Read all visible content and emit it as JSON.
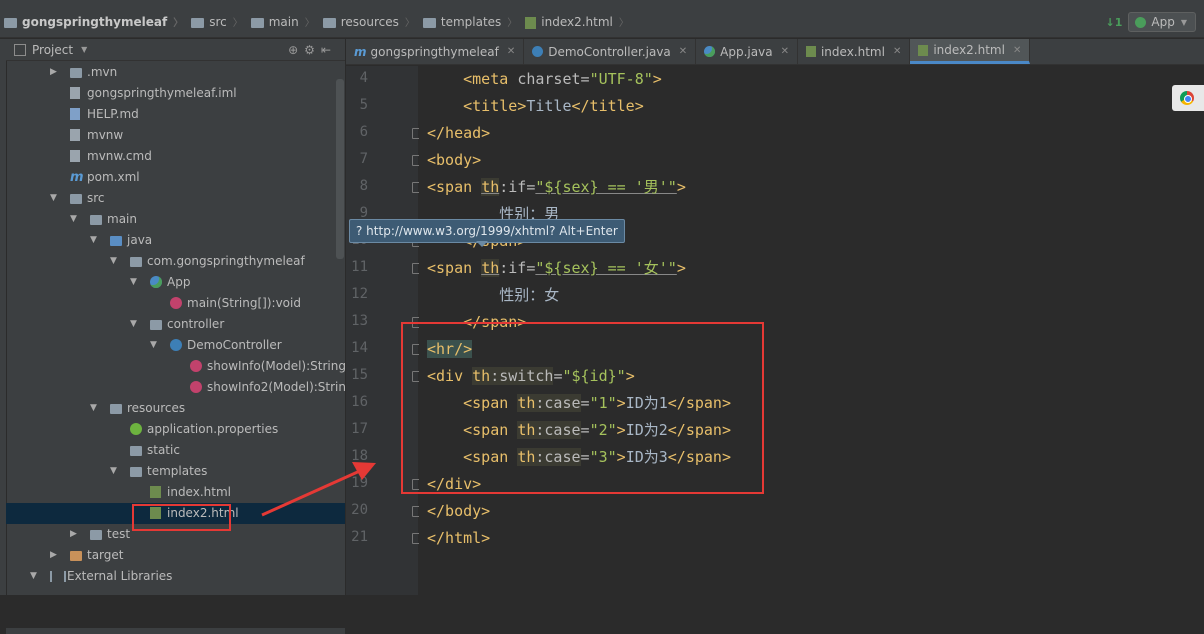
{
  "navbar": {
    "crumbs": [
      {
        "label": "gongspringthymeleaf",
        "icon": "folder-icon"
      },
      {
        "label": "src",
        "icon": "folder-icon"
      },
      {
        "label": "main",
        "icon": "folder-icon"
      },
      {
        "label": "resources",
        "icon": "folder-icon"
      },
      {
        "label": "templates",
        "icon": "folder-icon"
      },
      {
        "label": "index2.html",
        "icon": "html-file-icon"
      }
    ],
    "run_config": "App"
  },
  "project_panel": {
    "title": "Project",
    "tree": [
      {
        "label": ".mvn",
        "depth": 1,
        "toggle": "collapsed",
        "icon": "folder"
      },
      {
        "label": "gongspringthymeleaf.iml",
        "depth": 1,
        "toggle": "",
        "icon": "file"
      },
      {
        "label": "HELP.md",
        "depth": 1,
        "toggle": "",
        "icon": "md"
      },
      {
        "label": "mvnw",
        "depth": 1,
        "toggle": "",
        "icon": "file"
      },
      {
        "label": "mvnw.cmd",
        "depth": 1,
        "toggle": "",
        "icon": "file"
      },
      {
        "label": "pom.xml",
        "depth": 1,
        "toggle": "",
        "icon": "m"
      },
      {
        "label": "src",
        "depth": 1,
        "toggle": "expanded",
        "icon": "folder"
      },
      {
        "label": "main",
        "depth": 2,
        "toggle": "expanded",
        "icon": "folder"
      },
      {
        "label": "java",
        "depth": 3,
        "toggle": "expanded",
        "icon": "folder-blue"
      },
      {
        "label": "com.gongspringthymeleaf",
        "depth": 4,
        "toggle": "expanded",
        "icon": "folder"
      },
      {
        "label": "App",
        "depth": 5,
        "toggle": "expanded",
        "icon": "app"
      },
      {
        "label": "main(String[]):void",
        "depth": 6,
        "toggle": "",
        "icon": "method"
      },
      {
        "label": "controller",
        "depth": 5,
        "toggle": "expanded",
        "icon": "folder"
      },
      {
        "label": "DemoController",
        "depth": 6,
        "toggle": "expanded",
        "icon": "c"
      },
      {
        "label": "showInfo(Model):String",
        "depth": 7,
        "toggle": "",
        "icon": "method"
      },
      {
        "label": "showInfo2(Model):String",
        "depth": 7,
        "toggle": "",
        "icon": "method"
      },
      {
        "label": "resources",
        "depth": 3,
        "toggle": "expanded",
        "icon": "folder"
      },
      {
        "label": "application.properties",
        "depth": 4,
        "toggle": "",
        "icon": "props"
      },
      {
        "label": "static",
        "depth": 4,
        "toggle": "",
        "icon": "folder"
      },
      {
        "label": "templates",
        "depth": 4,
        "toggle": "expanded",
        "icon": "folder"
      },
      {
        "label": "index.html",
        "depth": 5,
        "toggle": "",
        "icon": "html"
      },
      {
        "label": "index2.html",
        "depth": 5,
        "toggle": "",
        "icon": "html",
        "selected": true
      },
      {
        "label": "test",
        "depth": 2,
        "toggle": "collapsed",
        "icon": "folder"
      },
      {
        "label": "target",
        "depth": 1,
        "toggle": "collapsed",
        "icon": "folder-orange"
      },
      {
        "label": "External Libraries",
        "depth": 0,
        "toggle": "expanded",
        "icon": "libs"
      }
    ]
  },
  "editor_tabs": [
    {
      "label": "gongspringthymeleaf",
      "icon": "m",
      "active": false
    },
    {
      "label": "DemoController.java",
      "icon": "c",
      "active": false
    },
    {
      "label": "App.java",
      "icon": "app",
      "active": false
    },
    {
      "label": "index.html",
      "icon": "html",
      "active": false
    },
    {
      "label": "index2.html",
      "icon": "html",
      "active": true
    }
  ],
  "line_numbers": [
    "4",
    "5",
    "6",
    "7",
    "8",
    "9",
    "10",
    "11",
    "12",
    "13",
    "14",
    "15",
    "16",
    "17",
    "18",
    "19",
    "20",
    "21"
  ],
  "code_text": {
    "meta_a": "<meta ",
    "meta_b": "charset",
    "meta_c": "=",
    "meta_d": "\"UTF-8\"",
    "meta_e": ">",
    "title_a": "<title>",
    "title_b": "Title",
    "title_c": "</title>",
    "head_close": "</head>",
    "body_open": "<body>",
    "span1_a": "<span ",
    "span1_b": "th",
    "span1_c": ":if",
    "span1_d": "=",
    "span1_e": "\"${sex} == '男'\"",
    "span1_f": ">",
    "line9": "性别：男",
    "span_close_10": "</span>",
    "span2_a": "<span ",
    "span2_b": "th",
    "span2_c": ":if",
    "span2_d": "=",
    "span2_e": "\"${sex} == '女'\"",
    "span2_f": ">",
    "line12": "性别：女",
    "span_close_13": "</span>",
    "hr_a": "<hr",
    "hr_b": "/>",
    "div_a": "<div ",
    "div_b": "th",
    "div_c": ":switch",
    "div_d": "=",
    "div_e": "\"${id}\"",
    "div_f": ">",
    "case1_a": "<span ",
    "case1_b": "th",
    "case1_c": ":case",
    "case1_d": "=",
    "case1_e": "\"1\"",
    "case1_f": ">",
    "case1_g": "ID为1",
    "case1_h": "</span>",
    "case2_a": "<span ",
    "case2_b": "th",
    "case2_c": ":case",
    "case2_d": "=",
    "case2_e": "\"2\"",
    "case2_f": ">",
    "case2_g": "ID为2",
    "case2_h": "</span>",
    "case3_a": "<span ",
    "case3_b": "th",
    "case3_c": ":case",
    "case3_d": "=",
    "case3_e": "\"3\"",
    "case3_f": ">",
    "case3_g": "ID为3",
    "case3_h": "</span>",
    "div_close": "</div>",
    "body_close": "</body>",
    "html_close": "</html>"
  },
  "tooltip": "? http://www.w3.org/1999/xhtml? Alt+Enter"
}
